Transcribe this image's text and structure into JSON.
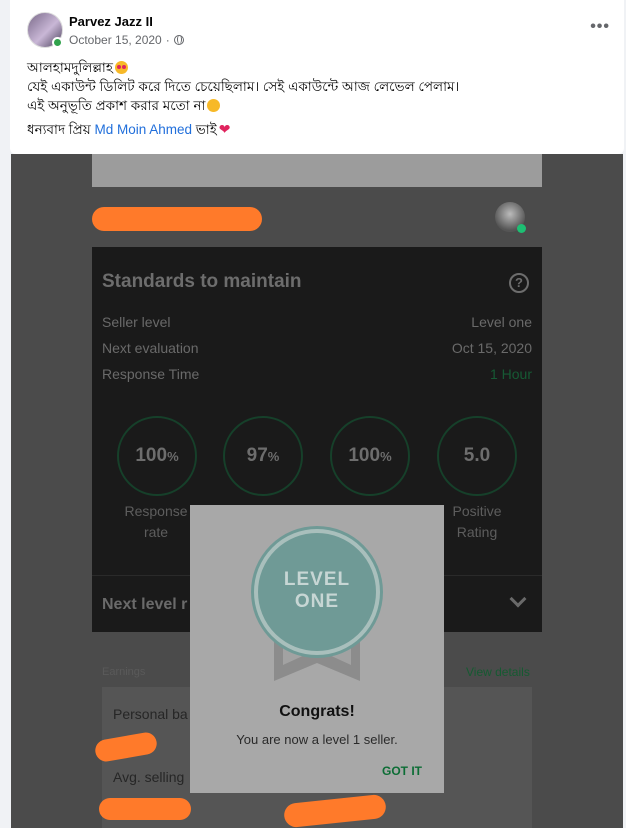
{
  "post": {
    "author": "Parvez Jazz II",
    "date": "October 15, 2020",
    "separator": "·",
    "privacy_icon": "globe-icon",
    "more_label": "•••",
    "line1": "আলহামদুলিল্লাহ",
    "line2": "যেই একাউন্ট ডিলিট  করে দিতে চেয়েছিলাম। সেই একাউন্টে আজ লেভেল পেলাম।",
    "line3": "এই অনুভূতি  প্রকাশ করার মতো না",
    "line4_prefix": "ধন্যবাদ প্রিয় ",
    "mention": "Md Moin Ahmed",
    "line4_suffix": " ভাই",
    "heart": "❤"
  },
  "standards": {
    "title": "Standards to maintain",
    "help": "?",
    "rows": [
      {
        "label": "Seller level",
        "value": "Level one"
      },
      {
        "label": "Next evaluation",
        "value": "Oct 15, 2020"
      },
      {
        "label": "Response Time",
        "value": "1 Hour"
      }
    ],
    "metrics": [
      {
        "num": "100",
        "unit": "%",
        "label1": "Response",
        "label2": "rate"
      },
      {
        "num": "97",
        "unit": "%"
      },
      {
        "num": "100",
        "unit": "%"
      },
      {
        "num": "5.0",
        "unit": "",
        "label1": "Positive",
        "label2": "Rating"
      }
    ],
    "next_level": "Next level r"
  },
  "earnings": {
    "label": "Earnings",
    "view_details": "View details",
    "personal_balance": "Personal ba",
    "avg_selling": "Avg. selling"
  },
  "dialog": {
    "badge_line1": "LEVEL",
    "badge_line2": "ONE",
    "title": "Congrats!",
    "message": "You are now a level 1 seller.",
    "button": "GOT IT"
  }
}
